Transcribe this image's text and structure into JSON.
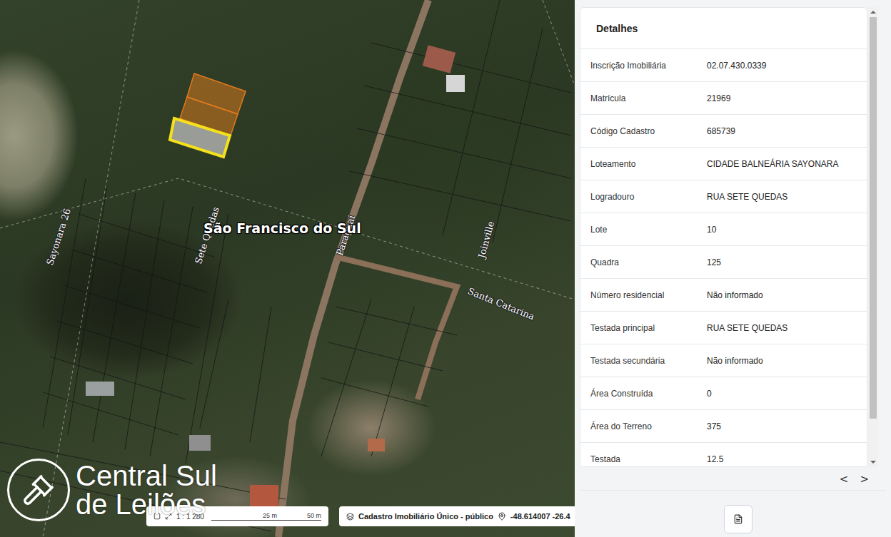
{
  "map": {
    "city": "São Francisco do Sul",
    "streets": [
      "Sayonara 26",
      "Sete Quedas",
      "Paraguai",
      "Joinville",
      "Santa Catarina"
    ],
    "lots": [
      {
        "selected": false
      },
      {
        "selected": false
      },
      {
        "selected": true
      }
    ],
    "scale": {
      "ratio": "1 : 1 280",
      "ticks": [
        "25 m",
        "50 m"
      ]
    },
    "layer": "Cadastro Imobiliário Único - público",
    "coordinates": "-48.614007 -26.4"
  },
  "watermark": {
    "lines": [
      "Central Sul",
      "de Leilões"
    ]
  },
  "details": {
    "title": "Detalhes",
    "rows": [
      {
        "label": "Inscrição Imobiliária",
        "value": "02.07.430.0339"
      },
      {
        "label": "Matrícula",
        "value": "21969"
      },
      {
        "label": "Código Cadastro",
        "value": "685739"
      },
      {
        "label": "Loteamento",
        "value": "CIDADE BALNEÁRIA SAYONARA"
      },
      {
        "label": "Logradouro",
        "value": "RUA SETE QUEDAS"
      },
      {
        "label": "Lote",
        "value": "10"
      },
      {
        "label": "Quadra",
        "value": "125"
      },
      {
        "label": "Número residencial",
        "value": "Não informado"
      },
      {
        "label": "Testada principal",
        "value": "RUA SETE QUEDAS"
      },
      {
        "label": "Testada secundária",
        "value": "Não informado"
      },
      {
        "label": "Área Construída",
        "value": "0"
      },
      {
        "label": "Área do Terreno",
        "value": "375"
      },
      {
        "label": "Testada",
        "value": "12.5"
      }
    ]
  },
  "pager": {
    "prev": "<",
    "next": ">"
  }
}
